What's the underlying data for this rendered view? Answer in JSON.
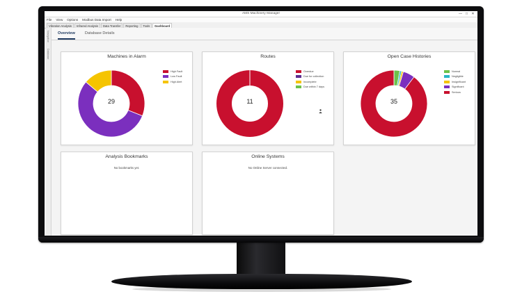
{
  "window": {
    "title": "AMS Machinery Manager",
    "controls": [
      "—",
      "□",
      "✕"
    ]
  },
  "menu": [
    "File",
    "View",
    "Options",
    "Modbus Data Import",
    "Help"
  ],
  "tabs": [
    {
      "label": "Vibration Analysis",
      "active": false
    },
    {
      "label": "Infrared Analysis",
      "active": false
    },
    {
      "label": "Data Transfer",
      "active": false
    },
    {
      "label": "Reporting",
      "active": false
    },
    {
      "label": "Tools",
      "active": false
    },
    {
      "label": "Dashboard",
      "active": true
    }
  ],
  "side_strip": [
    "Navigation",
    "Database"
  ],
  "subtabs": [
    {
      "label": "Overview",
      "active": true
    },
    {
      "label": "Database Details",
      "active": false
    }
  ],
  "colors": {
    "red": "#c8102e",
    "purple": "#7b2fbe",
    "yellow": "#f5c400",
    "dark_purple": "#5c2d91",
    "green": "#6cc24a",
    "teal": "#29b6c6",
    "crimson": "#b5003c"
  },
  "cards": {
    "machines_in_alarm": {
      "title": "Machines in Alarm",
      "center": "29",
      "legend": [
        "High Fault",
        "Low Fault",
        "High Alert"
      ],
      "segments": [
        {
          "label": "High Fault",
          "value": 9,
          "color": "#c8102e"
        },
        {
          "label": "Low Fault",
          "value": 16,
          "color": "#7b2fbe"
        },
        {
          "label": "High Alert",
          "value": 4,
          "color": "#f5c400"
        }
      ]
    },
    "routes": {
      "title": "Routes",
      "center": "11",
      "legend": [
        "Overdue",
        "Due for collection",
        "Incomplete",
        "Due within 7 days"
      ],
      "legend_colors": [
        "#c8102e",
        "#5c2d91",
        "#f5c400",
        "#6cc24a"
      ],
      "segments": [
        {
          "label": "Overdue",
          "value": 11,
          "color": "#c8102e"
        }
      ],
      "icon": "person-icon"
    },
    "open_case_histories": {
      "title": "Open Case Histories",
      "center": "35",
      "legend": [
        "Normal",
        "Negligible",
        "Insignificant",
        "Significant",
        "Serious"
      ],
      "legend_colors": [
        "#6cc24a",
        "#29b6c6",
        "#f5c400",
        "#7b2fbe",
        "#c8102e"
      ],
      "segments": [
        {
          "label": "Normal",
          "value": 1,
          "color": "#6cc24a"
        },
        {
          "label": "Negligible",
          "value": 0.3,
          "color": "#29b6c6"
        },
        {
          "label": "Insignificant",
          "value": 0.3,
          "color": "#f5c400"
        },
        {
          "label": "Significant",
          "value": 2,
          "color": "#7b2fbe"
        },
        {
          "label": "Serious",
          "value": 31.4,
          "color": "#c8102e"
        }
      ]
    },
    "analysis_bookmarks": {
      "title": "Analysis Bookmarks",
      "message": "No bookmarks yet."
    },
    "online_systems": {
      "title": "Online Systems",
      "message": "No Online Server connected."
    }
  }
}
